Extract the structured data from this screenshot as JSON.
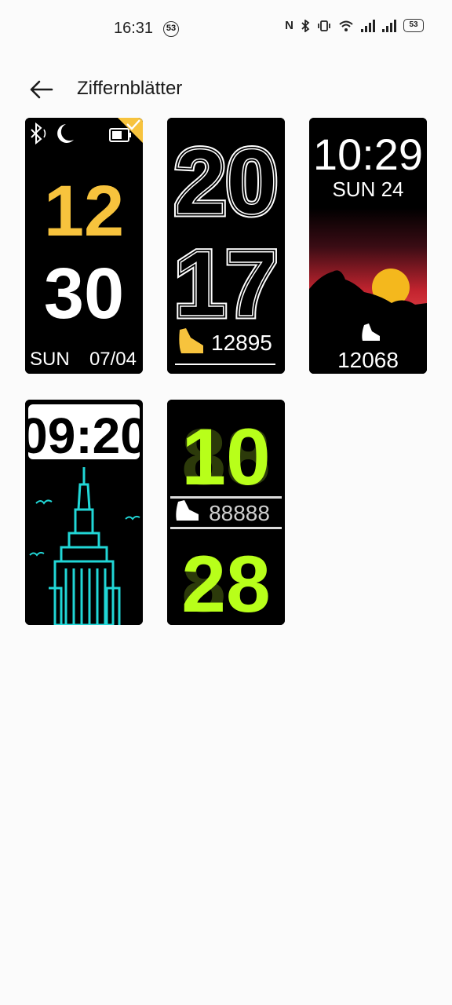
{
  "status_bar": {
    "time": "16:31",
    "notification_count": "53",
    "battery": "53",
    "icons": [
      "nfc-icon",
      "bluetooth-icon",
      "vibrate-icon",
      "wifi-icon",
      "signal-icon",
      "signal-icon"
    ]
  },
  "header": {
    "title": "Ziffernblätter",
    "back_icon": "arrow-left-icon"
  },
  "faces": [
    {
      "hour": "12",
      "minute": "30",
      "day": "SUN",
      "date": "07/04",
      "selected": true,
      "accent": "#f7c33d",
      "icons": [
        "bluetooth-icon",
        "moon-icon",
        "battery-icon",
        "checkmark-icon"
      ]
    },
    {
      "hour": "20",
      "minute": "17",
      "steps": "12895",
      "icons": [
        "shoe-icon"
      ]
    },
    {
      "time": "10:29",
      "date": "SUN 24",
      "steps": "12068",
      "icons": [
        "sun-icon",
        "shoe-icon"
      ]
    },
    {
      "time": "09:20",
      "icons": [
        "empire-state-building-icon",
        "bird-icon"
      ],
      "accent": "#21d6d6"
    },
    {
      "hour": "10",
      "minute": "28",
      "steps": "88888",
      "accent": "#b8ff1a",
      "icons": [
        "shoe-icon"
      ]
    }
  ]
}
